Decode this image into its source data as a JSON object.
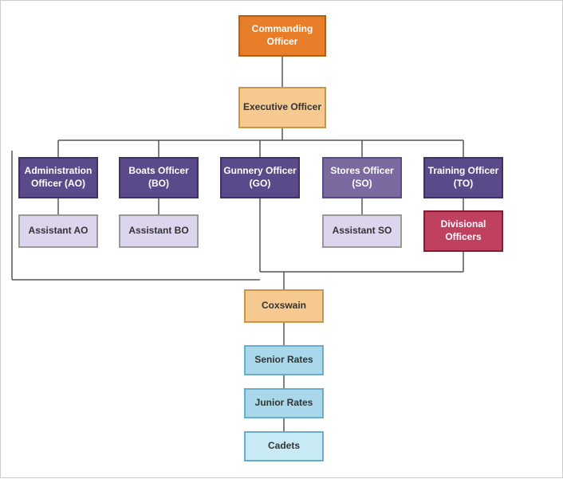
{
  "nodes": {
    "commanding_officer": "Commanding Officer",
    "executive_officer": "Executive Officer",
    "ao": "Administration Officer (AO)",
    "bo": "Boats Officer (BO)",
    "go": "Gunnery Officer (GO)",
    "so": "Stores Officer (SO)",
    "to": "Training Officer (TO)",
    "asst_ao": "Assistant AO",
    "asst_bo": "Assistant BO",
    "asst_so": "Assistant SO",
    "div_officers": "Divisional Officers",
    "coxswain": "Coxswain",
    "senior_rates": "Senior Rates",
    "junior_rates": "Junior Rates",
    "cadets": "Cadets"
  }
}
